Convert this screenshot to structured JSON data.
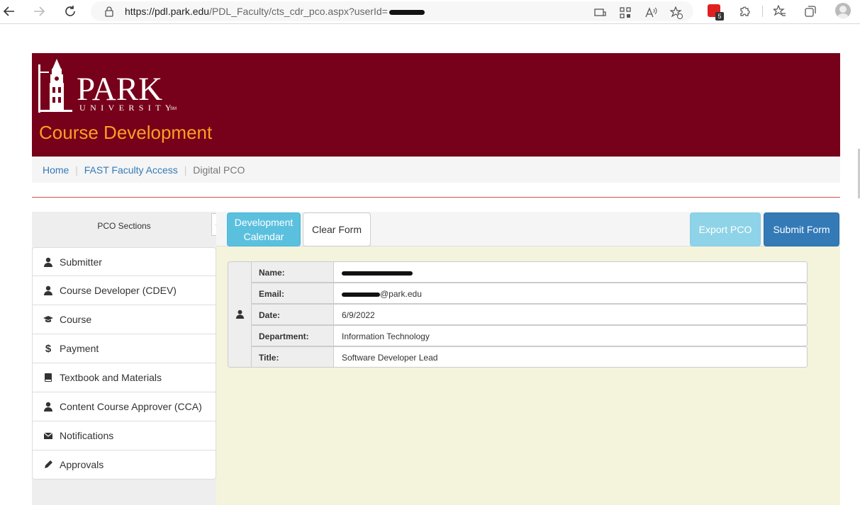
{
  "browser": {
    "url_host": "https://pdl.park.edu",
    "url_path": "/PDL_Faculty/cts_cdr_pco.aspx?userId=",
    "extension_badge": "5"
  },
  "header": {
    "logo_park": "PARK",
    "logo_university": "UNIVERSITY",
    "logo_tm": "SM",
    "site_title": "Course Development",
    "background": "#77001a",
    "title_color": "#ff9e24"
  },
  "breadcrumb": {
    "items": [
      "Home",
      "FAST Faculty Access"
    ],
    "current": "Digital PCO"
  },
  "sidebar": {
    "heading": "PCO Sections",
    "items": [
      {
        "label": "Submitter",
        "icon": "user-icon"
      },
      {
        "label": "Course Developer (CDEV)",
        "icon": "user-icon"
      },
      {
        "label": "Course",
        "icon": "graduation-cap-icon"
      },
      {
        "label": "Payment",
        "icon": "dollar-icon"
      },
      {
        "label": "Textbook and Materials",
        "icon": "book-icon"
      },
      {
        "label": "Content Course Approver (CCA)",
        "icon": "user-icon"
      },
      {
        "label": "Notifications",
        "icon": "envelope-icon"
      },
      {
        "label": "Approvals",
        "icon": "pencil-icon"
      }
    ]
  },
  "toolbar": {
    "dev_calendar_line1": "Development",
    "dev_calendar_line2": "Calendar",
    "clear_form": "Clear Form",
    "export_pco": "Export PCO",
    "submit_form": "Submit Form"
  },
  "submitter": {
    "fields": [
      {
        "label": "Name:",
        "value": ""
      },
      {
        "label": "Email:",
        "value": "@park.edu"
      },
      {
        "label": "Date:",
        "value": "6/9/2022"
      },
      {
        "label": "Department:",
        "value": "Information Technology"
      },
      {
        "label": "Title:",
        "value": "Software Developer Lead"
      }
    ]
  }
}
